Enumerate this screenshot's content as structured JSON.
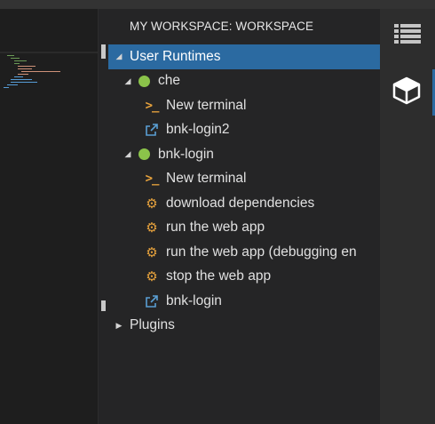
{
  "panel": {
    "title": "MY WORKSPACE: WORKSPACE"
  },
  "tree": {
    "root": {
      "label": "User Runtimes",
      "expanded": true
    },
    "machines": [
      {
        "label": "che",
        "status_color": "#8bc34a",
        "items": [
          {
            "label": "New terminal",
            "icon": "terminal-icon"
          },
          {
            "label": "bnk-login2",
            "icon": "external-link-icon"
          }
        ]
      },
      {
        "label": "bnk-login",
        "status_color": "#8bc34a",
        "items": [
          {
            "label": "New terminal",
            "icon": "terminal-icon"
          },
          {
            "label": "download dependencies",
            "icon": "gears-icon"
          },
          {
            "label": "run the web app",
            "icon": "gears-icon"
          },
          {
            "label": "run the web app (debugging en",
            "icon": "gears-icon"
          },
          {
            "label": "stop the web app",
            "icon": "gears-icon"
          },
          {
            "label": "bnk-login",
            "icon": "external-link-icon"
          }
        ]
      }
    ],
    "plugins": {
      "label": "Plugins",
      "expanded": false
    }
  },
  "sidebar": {
    "buttons": [
      {
        "icon": "list-icon",
        "active": false
      },
      {
        "icon": "cube-icon",
        "active": true
      }
    ]
  },
  "colors": {
    "accent": "#2b6aa1",
    "running": "#8bc34a",
    "command": "#e8a33d",
    "link": "#5a9fd4"
  }
}
